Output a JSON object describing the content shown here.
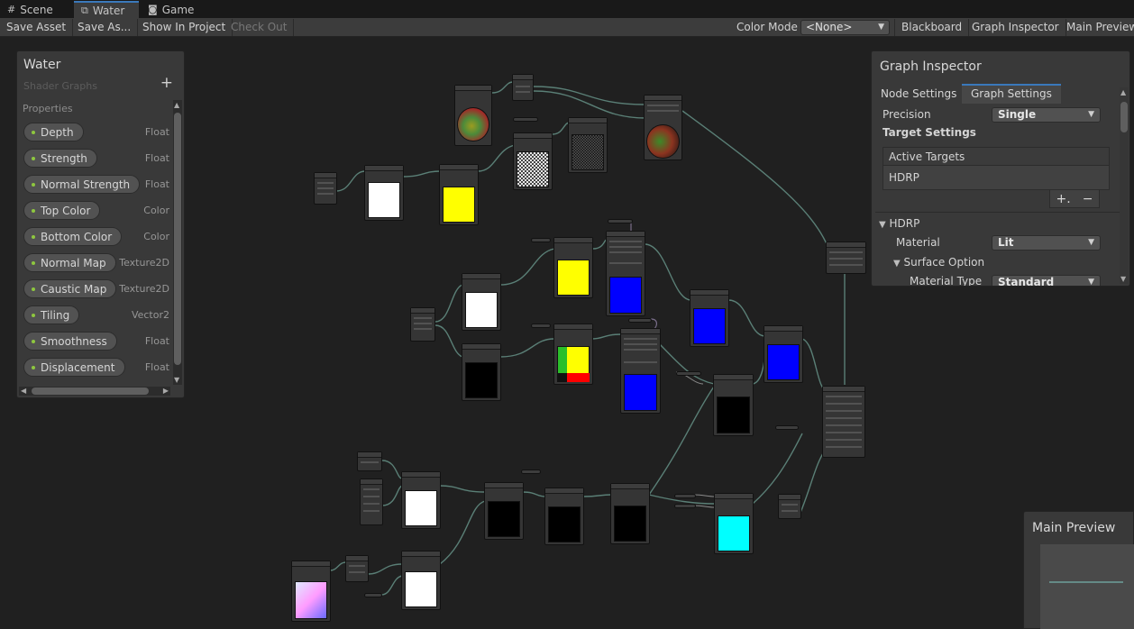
{
  "tabs": [
    {
      "label": "Scene",
      "icon": "grid-icon"
    },
    {
      "label": "Water",
      "icon": "shader-graph-icon",
      "active": true
    },
    {
      "label": "Game",
      "icon": "gamepad-icon"
    }
  ],
  "toolbar": {
    "save_asset": "Save Asset",
    "save_as": "Save As...",
    "show_in_project": "Show In Project",
    "check_out": "Check Out",
    "color_mode_label": "Color Mode",
    "color_mode_value": "<None>",
    "blackboard": "Blackboard",
    "graph_inspector": "Graph Inspector",
    "main_preview": "Main Preview"
  },
  "blackboard": {
    "title": "Water",
    "subtitle": "Shader Graphs",
    "add_label": "+",
    "section": "Properties",
    "properties": [
      {
        "name": "Depth",
        "type": "Float"
      },
      {
        "name": "Strength",
        "type": "Float"
      },
      {
        "name": "Normal Strength",
        "type": "Float"
      },
      {
        "name": "Top Color",
        "type": "Color"
      },
      {
        "name": "Bottom Color",
        "type": "Color"
      },
      {
        "name": "Normal Map",
        "type": "Texture2D"
      },
      {
        "name": "Caustic Map",
        "type": "Texture2D"
      },
      {
        "name": "Tiling",
        "type": "Vector2"
      },
      {
        "name": "Smoothness",
        "type": "Float"
      },
      {
        "name": "Displacement",
        "type": "Float"
      }
    ]
  },
  "inspector": {
    "title": "Graph Inspector",
    "tabs": [
      "Node Settings",
      "Graph Settings"
    ],
    "active_tab": "Graph Settings",
    "precision_label": "Precision",
    "precision_value": "Single",
    "target_settings": "Target Settings",
    "active_targets": "Active Targets",
    "targets": [
      "HDRP"
    ],
    "plus": "+.",
    "minus": "−",
    "hdrp_section": "HDRP",
    "material_label": "Material",
    "material_value": "Lit",
    "surface_option": "Surface Option",
    "material_type_label": "Material Type",
    "material_type_value": "Standard"
  },
  "main_preview": {
    "title": "Main Preview"
  },
  "colors": {
    "accent": "#3a79bb",
    "property_dot": "#8ec73f",
    "wire": "#5a7f76",
    "preview_yellow": "#ffff00",
    "preview_blue": "#0000ff",
    "preview_cyan": "#00ffff",
    "preview_white": "#ffffff",
    "preview_black": "#000000"
  }
}
